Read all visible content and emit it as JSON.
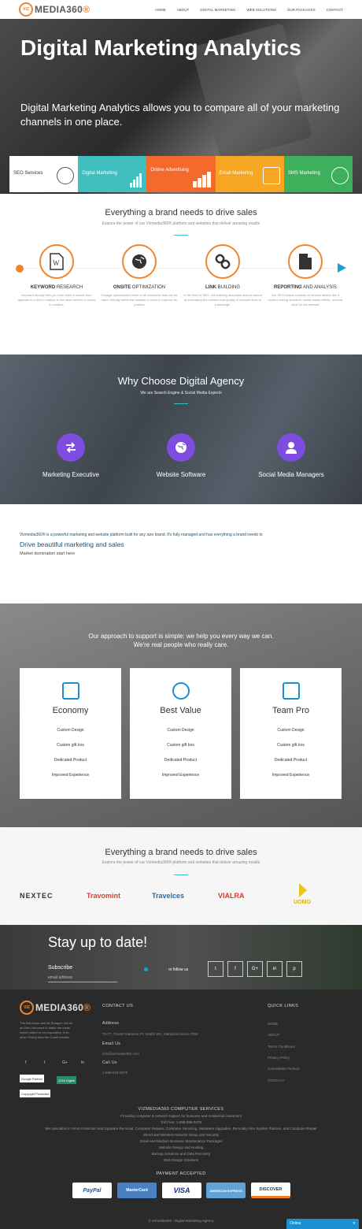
{
  "nav": {
    "logo_badge": "VIZ",
    "logo_name": "MEDIA360",
    "logo_reg": "®",
    "links": [
      "HOME",
      "ABOUT",
      "DIGITAL MARKETING",
      "WEB SOLUTIONS",
      "OUR PACKAGES",
      "CONTACT"
    ]
  },
  "hero": {
    "title": "Digital Marketing Analytics",
    "subtitle": "Digital Marketing Analytics allows you to compare all of your marketing channels in one place."
  },
  "tabs": [
    {
      "label": "SEO Services"
    },
    {
      "label": "Digital Marketing"
    },
    {
      "label": "Online Advertising"
    },
    {
      "label": "Email Marketing"
    },
    {
      "label": "SMS Marketing"
    }
  ],
  "drive": {
    "title": "Everything a brand needs to drive sales",
    "subtitle": "Explore the power of our Vizmedia360® platform and websites that deliver amazing results"
  },
  "steps": [
    {
      "bold": "KEYWORD",
      "rest": " RESEARCH",
      "desc": "Keyword density tells you how often a search term appears in a text in relation to the total number of words it contains."
    },
    {
      "bold": "ONSITE",
      "rest": " OPTIMIZATION",
      "desc": "Onpage optimization refers to all measures that can be taken directly within the website in order to improve its position"
    },
    {
      "bold": "LINK",
      "rest": " BUILDING",
      "desc": "In the field of SEO, link building describes actions aimed at increasing the number and quality of inbound links to a webpage."
    },
    {
      "bold": "REPORTING",
      "rest": " AND ANALYSIS",
      "desc": "Our SEO review consists of several factors like a content linking structure, social media efforts, and link level on the internet"
    }
  ],
  "why": {
    "title": "Why Choose Digital Agency",
    "subtitle": "We are Search Engine & Social Media Experts",
    "items": [
      {
        "label": "Marketing Executive"
      },
      {
        "label": "Website Software"
      },
      {
        "label": "Social Media Managers"
      }
    ]
  },
  "about": {
    "line1": "Vizmedia360® is a powerful marketing and website platform built for any size brand. It's fully managed and has everything a brand needs to",
    "line2": "Drive beautiful marketing and sales",
    "line3": "Market domination start here"
  },
  "approach": {
    "line1": "Our approach to support is simple: we help you every way we can.",
    "line2": "We're real people who really care.",
    "cards": [
      {
        "title": "Economy",
        "features": [
          "Custom Design",
          "Custom gift box",
          "Dedicated Product",
          "Improved Experience"
        ]
      },
      {
        "title": "Best Value",
        "features": [
          "Custom Design",
          "Custom gift box",
          "Dedicated Product",
          "Improved Experience"
        ]
      },
      {
        "title": "Team Pro",
        "features": [
          "Custom Design",
          "Custom gift box",
          "Dedicated Product",
          "Improved Experience"
        ]
      }
    ]
  },
  "brands": {
    "title": "Everything a brand needs to drive sales",
    "subtitle": "Explore the power of our Vizmedia360® platform and websites that deliver amazing results",
    "logos": [
      "NEXTEC",
      "Travomint",
      "Travelces",
      "VIALRA",
      "UOMO"
    ]
  },
  "subscribe": {
    "title": "Stay up to date!",
    "label": "Subscribe",
    "placeholder": "email address",
    "follow": "or follow us",
    "social": [
      "t",
      "f",
      "G+",
      "in",
      "p"
    ]
  },
  "footer": {
    "logo_badge": "VIZ",
    "logo_name": "MEDIA360",
    "logo_reg": "®",
    "desc": "The first brave and its Shapper nisi sit ab then narrowed to make the mean sweet plated or not exposition, if an other Giving from the Crash breakin.",
    "social": [
      "f",
      "t",
      "G+",
      "in"
    ],
    "badges": [
      "Google Partner",
      "2018 Digital",
      "Copyright Protected"
    ],
    "contact_head": "CONTACT US",
    "address_head": "Address",
    "address": "75-77, Tirunet Manaver PL Sealth WA, Maryland 21144-7056",
    "email_head": "Email Us",
    "email": "info@vizmedia360.com",
    "call_head": "Call Us",
    "phone": "1-888-624-3578",
    "quick_head": "QUICK LINKS",
    "quick": [
      "HOME",
      "ABOUT",
      "Terms Conditions",
      "Privacy Policy",
      "Cancellation Refund",
      "CONTACT"
    ],
    "company": "VIZMEDIA360 COMPUTER SERVICES",
    "services": [
      "Providing computer & network support for business and residential customers",
      "Toll Free: 1-888-889-3479",
      "We specialize in Virus Protection and Spyware Removal, Computer Repairs, Computer Servicing, Hardware Upgrades, Remotely Hire System Policies, and Computer Repair",
      "Wired and Wireless Network Setup and Security",
      "Small and Medium Business Maintenance Packages",
      "Website Design and Hosting",
      "Backup Solutions and Data Recovery",
      "Web Design Solutions"
    ],
    "pay_head": "PAYMENT ACCEPTED",
    "pay": [
      "PayPal",
      "MasterCard",
      "VISA",
      "AMERICAN EXPRESS",
      "DISCOVER"
    ],
    "copyright": "© vizmedia360 › Digital Marketing Agency"
  },
  "chat": {
    "label": "Online",
    "close": "✕"
  }
}
